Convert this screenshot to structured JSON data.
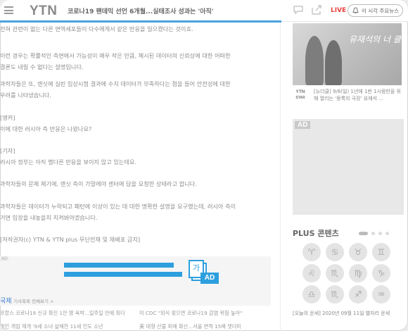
{
  "header": {
    "logo": "YTN",
    "headline": "코로나19 팬데믹 선언 6개월...실태조사 성과는 '아직'",
    "live": "LIVE",
    "alert_button": "이 시각 주요뉴스",
    "progress_fraction": 0.69,
    "colors": {
      "live": "#e8433d",
      "progress": "#4aa3df"
    }
  },
  "article": {
    "paragraphs": [
      [
        "전혀 관련이 없는 다른 면역세포들이 다수에게서 같은 반응을 일으켰다는 것이죠."
      ],
      [
        "이런 경우는 확률적인 측면에서 가능성이 매우 작은 만큼, 제시된 데이터의 신뢰성에 대한 어떠한",
        "결론도 내릴 수 없다는 설명입니다."
      ],
      [
        "과학자들은 또, 랜싯에 실린 임상시험 결과에 수치 데이터가 부족하다는 점을 들어 안전성에 대한",
        "우려를 나타냈습니다."
      ],
      [
        "[앵커]",
        "이에 대한 러시아 측 반응은 나왔나요?"
      ],
      [
        "[기자]",
        "러시아 정부는 아직 별다른 반응을 보이지 않고 있는데요."
      ],
      [
        "과학자들의 문제 제기에, 랜싯 측이 가말레야 센터에 답을 요청한 상태라고 합니다."
      ],
      [
        "과학자들은 데이터가 누락되고 패턴에 이상이 있는 데 대한 명확한 설명을 요구했는데, 러시아 측이",
        "거면 입장을 내놓을지 지켜봐야겠습니다."
      ],
      [
        "[저작권자(c) YTN & YTN plus 무단전재 및 재배포 금지]"
      ]
    ],
    "ad_small": "AD",
    "ad_ga": "가",
    "ad_label": "AD",
    "section": "국제",
    "section_more": "기사목록 전체보기 >",
    "related": [
      {
        "left": "프랑스 코로나19 신규 확진 1만 명 육박...일주일 만에 최다",
        "right": "미 CDC \"외식 잦으면 코로나19 감염 위험 높아\""
      },
      {
        "left": "과인 게임 재개 '9세 소녀 살해한 11세 인도 소년",
        "right": "美 대형 산불 피해 확산...서울 면적 15배 잿더미"
      }
    ]
  },
  "sidebar": {
    "banner_title": "유재석의 너 클래식",
    "news_logo": "YTN",
    "news_logo_sub": "STAR",
    "news_text": "[뉴더클] 9/6(일) 1년에 1번 1시람만을 위해 열리는 '몽룩의 극장' 유재석 ...",
    "ad_label": "AD",
    "plus_title": "PLUS 콘텐츠",
    "zodiac_icons": [
      "♈",
      "♋",
      "♉",
      "♊",
      "♌",
      "♏",
      "♍",
      "♑",
      "♎",
      "♏",
      "♐",
      "♒"
    ],
    "fortune": "[오늘의 운세] 2020년 09월 11일 별자리 운세"
  }
}
